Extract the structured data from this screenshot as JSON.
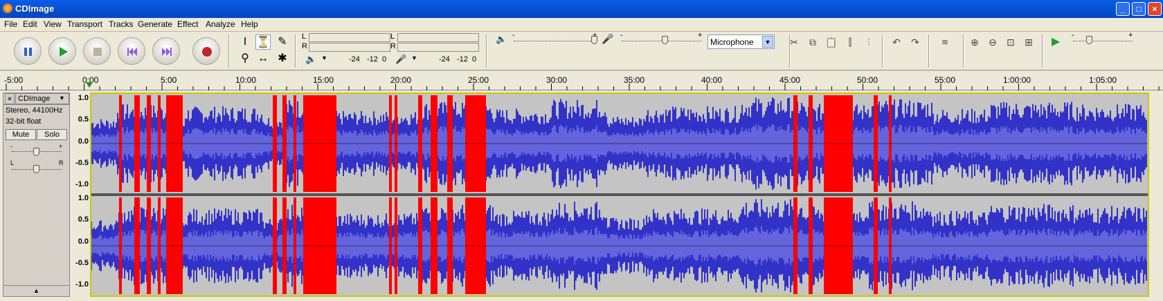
{
  "window": {
    "title": "CDImage",
    "min": "_",
    "max": "□",
    "close": "×"
  },
  "menu": [
    "File",
    "Edit",
    "View",
    "Transport",
    "Tracks",
    "Generate",
    "Effect",
    "Analyze",
    "Help"
  ],
  "meters": {
    "out_l": "L",
    "out_r": "R",
    "in_l": "L",
    "in_r": "R",
    "out_scale": [
      "-24",
      "-12",
      "0"
    ],
    "in_scale": [
      "-24",
      "-12",
      "0"
    ]
  },
  "mixer": {
    "out_minus": "-",
    "out_plus": "+",
    "in_minus": "-",
    "in_plus": "+",
    "input_source": "Microphone",
    "play_minus": "-",
    "play_plus": "+"
  },
  "ruler": {
    "labels": [
      "-5:00",
      "0:00",
      "5:00",
      "10:00",
      "15:00",
      "20:00",
      "25:00",
      "30:00",
      "35:00",
      "40:00",
      "45:00",
      "50:00",
      "55:00",
      "1:00:00",
      "1:05:00"
    ]
  },
  "track": {
    "close": "×",
    "name": "CDImage",
    "info1": "Stereo, 44100Hz",
    "info2": "32-bit float",
    "mute": "Mute",
    "solo": "Solo",
    "gain_minus": "-",
    "gain_plus": "+",
    "pan_l": "L",
    "pan_r": "R",
    "collapse": "▲"
  },
  "vscale": [
    "1.0",
    "0.5",
    "0.0",
    "-0.5",
    "-1.0"
  ],
  "colors": {
    "wave": "#3232c8",
    "wave_rms": "#6464dc",
    "clip": "#ff0000",
    "bg": "#c4c4c4"
  }
}
